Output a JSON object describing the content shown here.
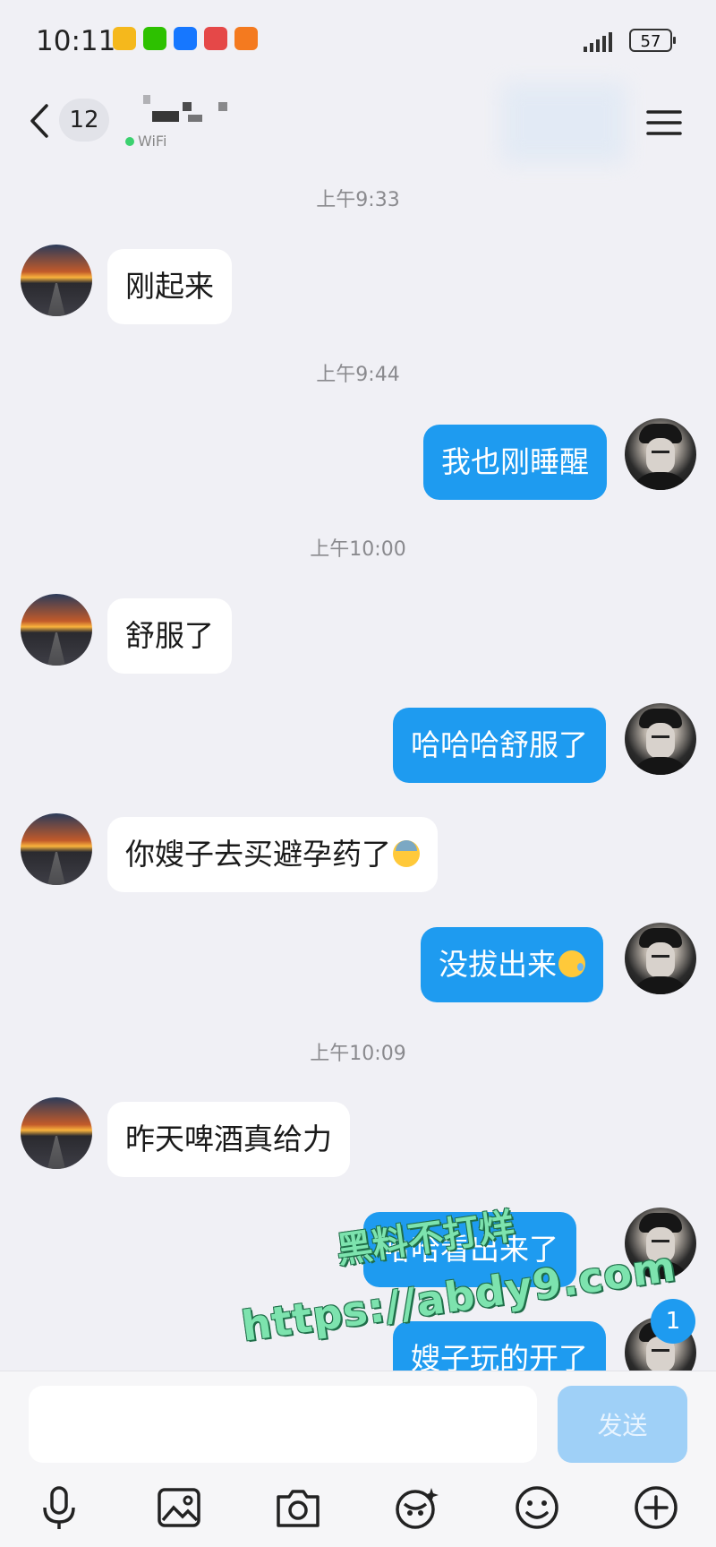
{
  "status_bar": {
    "time": "10:11",
    "battery": "57"
  },
  "header": {
    "unread_count": "12",
    "contact_status": "WiFi"
  },
  "messages": [
    {
      "type": "timestamp",
      "text": "上午9:33"
    },
    {
      "type": "in",
      "text": "刚起来"
    },
    {
      "type": "timestamp",
      "text": "上午9:44"
    },
    {
      "type": "out",
      "text": "我也刚睡醒"
    },
    {
      "type": "timestamp",
      "text": "上午10:00"
    },
    {
      "type": "in",
      "text": "舒服了"
    },
    {
      "type": "out",
      "text": "哈哈哈舒服了"
    },
    {
      "type": "in",
      "text": "你嫂子去买避孕药了",
      "emoji": "sweat-icon"
    },
    {
      "type": "out",
      "text": "没拔出来",
      "emoji": "tear-icon"
    },
    {
      "type": "timestamp",
      "text": "上午10:09"
    },
    {
      "type": "in",
      "text": "昨天啤酒真给力"
    },
    {
      "type": "out",
      "text": "哈哈看出来了"
    },
    {
      "type": "out",
      "text": "嫂子玩的开了"
    }
  ],
  "new_message_badge": "1",
  "watermark": {
    "line1": "黑料不打烊",
    "line2": "https://abdy9.com"
  },
  "input": {
    "value": "",
    "placeholder": ""
  },
  "send_label": "发送",
  "toolbar": [
    "microphone-icon",
    "image-icon",
    "camera-icon",
    "red-packet-icon",
    "emoji-icon",
    "plus-icon"
  ],
  "colors": {
    "out_bubble": "#1e9bf0",
    "in_bubble": "#ffffff",
    "background": "#f0f0f5",
    "send_disabled": "#9fd0f7"
  }
}
